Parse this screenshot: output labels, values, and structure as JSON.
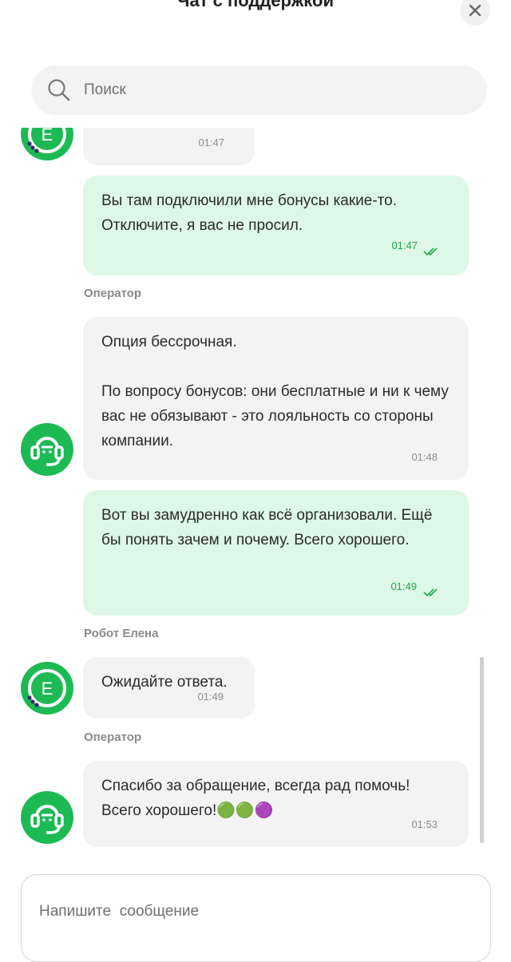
{
  "header": {
    "title": "Чат с поддержкой",
    "close_icon": "close-icon"
  },
  "search": {
    "placeholder": "Поиск",
    "icon": "search-icon"
  },
  "messages": [
    {
      "direction": "in",
      "text": "",
      "time": "01:47",
      "avatar": "robot-elena-avatar"
    },
    {
      "direction": "out",
      "text": "Вы там подключили мне бонусы какие-то. Отключите, я вас не просил.",
      "time": "01:47",
      "status": "read"
    },
    {
      "direction": "in",
      "sender": "Оператор",
      "text": "Опция бессрочная.\n\nПо вопросу бонусов: они бесплатные и ни к чему вас не обязывают - это лояльность со стороны компании.",
      "time": "01:48",
      "avatar": "operator-avatar"
    },
    {
      "direction": "out",
      "text": "Вот вы замудренно как всё организовали. Ещё бы понять зачем и почему. Всего хорошего.",
      "time": "01:49",
      "status": "read"
    },
    {
      "direction": "in",
      "sender": "Робот Елена",
      "text": "Ожидайте ответа.",
      "time": "01:49",
      "avatar": "robot-elena-avatar"
    },
    {
      "direction": "in",
      "sender": "Оператор",
      "text": "Спасибо за обращение, всегда рад помочь! Всего хорошего!🟢🟢🟣",
      "time": "01:53",
      "avatar": "operator-avatar"
    }
  ],
  "composer": {
    "placeholder": "Напишите  сообщение"
  },
  "colors": {
    "brand_green": "#1db954",
    "outgoing_bubble": "#ddf8e6",
    "incoming_bubble": "#f3f3f3",
    "time_green": "#1fa64b",
    "robot_dots": "#3a2b6e"
  }
}
